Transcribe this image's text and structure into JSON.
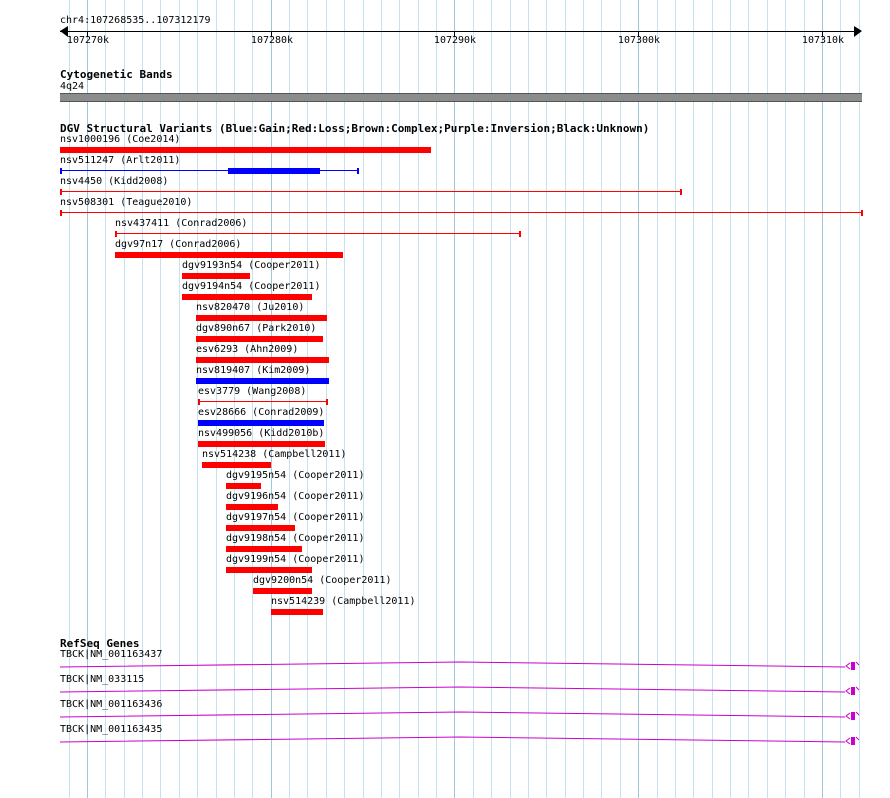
{
  "location": "chr4:107268535..107312179",
  "ruler": {
    "ticks": [
      "107270k",
      "107280k",
      "107290k",
      "107300k",
      "107310k"
    ]
  },
  "cytogenetic": {
    "title": "Cytogenetic Bands",
    "band": "4q24"
  },
  "dgv": {
    "title": "DGV Structural Variants (Blue:Gain;Red:Loss;Brown:Complex;Purple:Inversion;Black:Unknown)",
    "colors": {
      "gain": "#0000ff",
      "loss": "#ff0000"
    },
    "variants": [
      {
        "label": "nsv1000196 (Coe2014)",
        "type": "loss",
        "start": 107268535,
        "end": 107288700,
        "style": "thick"
      },
      {
        "label": "nsv511247 (Arlt2011)",
        "type": "gain",
        "start": 107268535,
        "end": 107284750,
        "style": "thin",
        "thick_start": 107277700,
        "thick_end": 107282700
      },
      {
        "label": "nsv4450 (Kidd2008)",
        "type": "loss",
        "start": 107268535,
        "end": 107302350,
        "style": "thin"
      },
      {
        "label": "nsv508301 (Teague2010)",
        "type": "loss",
        "start": 107268535,
        "end": 107312179,
        "style": "thin"
      },
      {
        "label": "nsv437411 (Conrad2006)",
        "type": "loss",
        "start": 107271550,
        "end": 107293550,
        "style": "thin"
      },
      {
        "label": "dgv97n17 (Conrad2006)",
        "type": "loss",
        "start": 107271550,
        "end": 107283950,
        "style": "thick"
      },
      {
        "label": "dgv9193n54 (Cooper2011)",
        "type": "loss",
        "start": 107275150,
        "end": 107278850,
        "style": "thick"
      },
      {
        "label": "dgv9194n54 (Cooper2011)",
        "type": "loss",
        "start": 107275150,
        "end": 107282250,
        "style": "thick"
      },
      {
        "label": "nsv820470 (Ju2010)",
        "type": "loss",
        "start": 107275950,
        "end": 107283050,
        "style": "thick"
      },
      {
        "label": "dgv890n67 (Park2010)",
        "type": "loss",
        "start": 107275950,
        "end": 107282850,
        "style": "thick"
      },
      {
        "label": "esv6293 (Ahn2009)",
        "type": "loss",
        "start": 107275950,
        "end": 107283200,
        "style": "thick"
      },
      {
        "label": "nsv819407 (Kim2009)",
        "type": "gain",
        "start": 107275950,
        "end": 107283200,
        "style": "thick"
      },
      {
        "label": "esv3779 (Wang2008)",
        "type": "loss",
        "start": 107276050,
        "end": 107283050,
        "style": "thin"
      },
      {
        "label": "esv28666 (Conrad2009)",
        "type": "gain",
        "start": 107276050,
        "end": 107282900,
        "style": "thick"
      },
      {
        "label": "nsv499056 (Kidd2010b)",
        "type": "loss",
        "start": 107276050,
        "end": 107282950,
        "style": "thick"
      },
      {
        "label": "nsv514238 (Campbell2011)",
        "type": "loss",
        "start": 107276250,
        "end": 107280000,
        "style": "thick"
      },
      {
        "label": "dgv9195n54 (Cooper2011)",
        "type": "loss",
        "start": 107277550,
        "end": 107279500,
        "style": "thick"
      },
      {
        "label": "dgv9196n54 (Cooper2011)",
        "type": "loss",
        "start": 107277550,
        "end": 107280400,
        "style": "thick"
      },
      {
        "label": "dgv9197n54 (Cooper2011)",
        "type": "loss",
        "start": 107277550,
        "end": 107281300,
        "style": "thick"
      },
      {
        "label": "dgv9198n54 (Cooper2011)",
        "type": "loss",
        "start": 107277550,
        "end": 107281700,
        "style": "thick"
      },
      {
        "label": "dgv9199n54 (Cooper2011)",
        "type": "loss",
        "start": 107277550,
        "end": 107282250,
        "style": "thick"
      },
      {
        "label": "dgv9200n54 (Cooper2011)",
        "type": "loss",
        "start": 107279050,
        "end": 107282250,
        "style": "thick"
      },
      {
        "label": "nsv514239 (Campbell2011)",
        "type": "loss",
        "start": 107280000,
        "end": 107282850,
        "style": "thick"
      }
    ]
  },
  "refseq": {
    "title": "RefSeq Genes",
    "color": "#cc00cc",
    "genes": [
      {
        "label": "TBCK|NM_001163437"
      },
      {
        "label": "TBCK|NM_033115"
      },
      {
        "label": "TBCK|NM_001163436"
      },
      {
        "label": "TBCK|NM_001163435"
      }
    ]
  }
}
